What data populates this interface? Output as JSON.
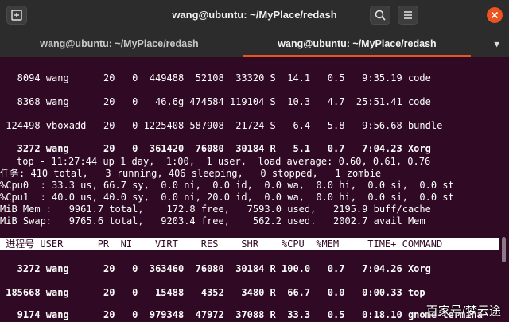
{
  "window": {
    "title": "wang@ubuntu: ~/MyPlace/redash"
  },
  "tabs": [
    {
      "label": "wang@ubuntu: ~/MyPlace/redash"
    },
    {
      "label": "wang@ubuntu: ~/MyPlace/redash"
    }
  ],
  "processes_top": [
    "   8094 wang      20   0  449488  52108  33320 S  14.1   0.5   9:35.19 code",
    "   8368 wang      20   0   46.6g 474584 119104 S  10.3   4.7  25:51.41 code",
    " 124498 vboxadd   20   0 1225408 587908  21724 S   6.4   5.8   9:56.68 bundle",
    "   3272 wang      20   0  361420  76080  30184 R   5.1   0.7   7:04.23 Xorg"
  ],
  "summary": [
    "top - 11:27:44 up 1 day,  1:00,  1 user,  load average: 0.60, 0.61, 0.76",
    "任务: 410 total,   3 running, 406 sleeping,   0 stopped,   1 zombie",
    "%Cpu0  : 33.3 us, 66.7 sy,  0.0 ni,  0.0 id,  0.0 wa,  0.0 hi,  0.0 si,  0.0 st",
    "%Cpu1  : 40.0 us, 40.0 sy,  0.0 ni, 20.0 id,  0.0 wa,  0.0 hi,  0.0 si,  0.0 st",
    "MiB Mem :   9961.7 total,    172.8 free,   7593.0 used,   2195.9 buff/cache",
    "MiB Swap:   9765.6 total,   9203.4 free,    562.2 used.   2002.7 avail Mem"
  ],
  "table_header": " 进程号 USER      PR  NI    VIRT    RES    SHR    %CPU  %MEM     TIME+ COMMAND",
  "processes_bottom": [
    "   3272 wang      20   0  363460  76080  30184 R 100.0   0.7   7:04.26 Xorg",
    " 185668 wang      20   0   15488   4352   3480 R  66.7   0.0   0:00.33 top",
    "   9174 wang      20   0  979348  47972  37088 R  33.3   0.5   0:18.10 gnome-termina"
  ],
  "watermark": "百家号/梦云途",
  "colors": {
    "accent": "#e95420",
    "terminal_bg": "#300a24",
    "header_bg": "#2c2c2c"
  }
}
